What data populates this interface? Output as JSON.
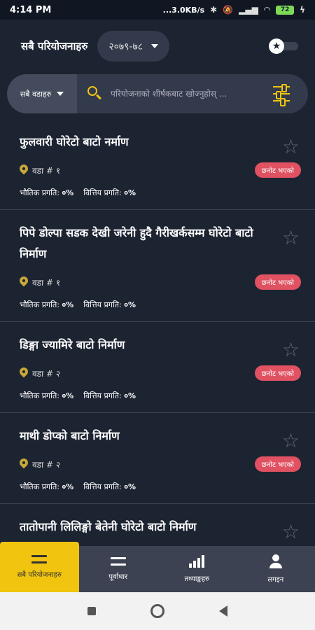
{
  "status_bar": {
    "time": "4:14 PM",
    "speed": "...3.0KB/s",
    "battery": "72"
  },
  "header": {
    "title": "सबै परियोजनाहरु",
    "year": "२०७९-७८"
  },
  "filter": {
    "ward_label": "सबै वडाहरु",
    "search_placeholder": "परियोजनाको शीर्षकबाट खोज्नुहोस् ..."
  },
  "projects": [
    {
      "title": "फुलवारी घोरेटो बाटो नर्माण",
      "ward": "वडा # १",
      "status": "छनोट भएको",
      "physical_label": "भौतिक प्रगति:",
      "physical_value": "०%",
      "financial_label": "वित्तिय प्रगति:",
      "financial_value": "०%"
    },
    {
      "title": "पिपे डोल्पा सडक देखी जरेनी हुदै गैरीखर्कसम्म घोरेटो बाटो निर्माण",
      "ward": "वडा # १",
      "status": "छनोट भएको",
      "physical_label": "भौतिक प्रगति:",
      "physical_value": "०%",
      "financial_label": "वित्तिय प्रगति:",
      "financial_value": "०%"
    },
    {
      "title": "डिङ्गा ज्यामिरे बाटो निर्माण",
      "ward": "वडा # २",
      "status": "छनोट भएको",
      "physical_label": "भौतिक प्रगति:",
      "physical_value": "०%",
      "financial_label": "वित्तिय प्रगति:",
      "financial_value": "०%"
    },
    {
      "title": "माथी डोप्को बाटो निर्माण",
      "ward": "वडा # २",
      "status": "छनोट भएको",
      "physical_label": "भौतिक प्रगति:",
      "physical_value": "०%",
      "financial_label": "वित्तिय प्रगति:",
      "financial_value": "०%"
    },
    {
      "title": "तातोपानी लिलिङ्गो बेतेनी घोरेटो बाटो निर्माण",
      "ward": "",
      "status": "",
      "physical_label": "",
      "physical_value": "",
      "financial_label": "",
      "financial_value": ""
    }
  ],
  "bottom_nav": {
    "items": [
      {
        "label": "सबै परियोजनाहरु",
        "icon": "menu-icon"
      },
      {
        "label": "पूर्वाधार",
        "icon": "menu-icon"
      },
      {
        "label": "तथ्याङ्कहरु",
        "icon": "chart-icon"
      },
      {
        "label": "लगइन",
        "icon": "user-icon"
      }
    ]
  },
  "colors": {
    "background": "#1c2331",
    "accent": "#f1c40f",
    "badge": "#e05162",
    "panel": "#323a4b"
  }
}
